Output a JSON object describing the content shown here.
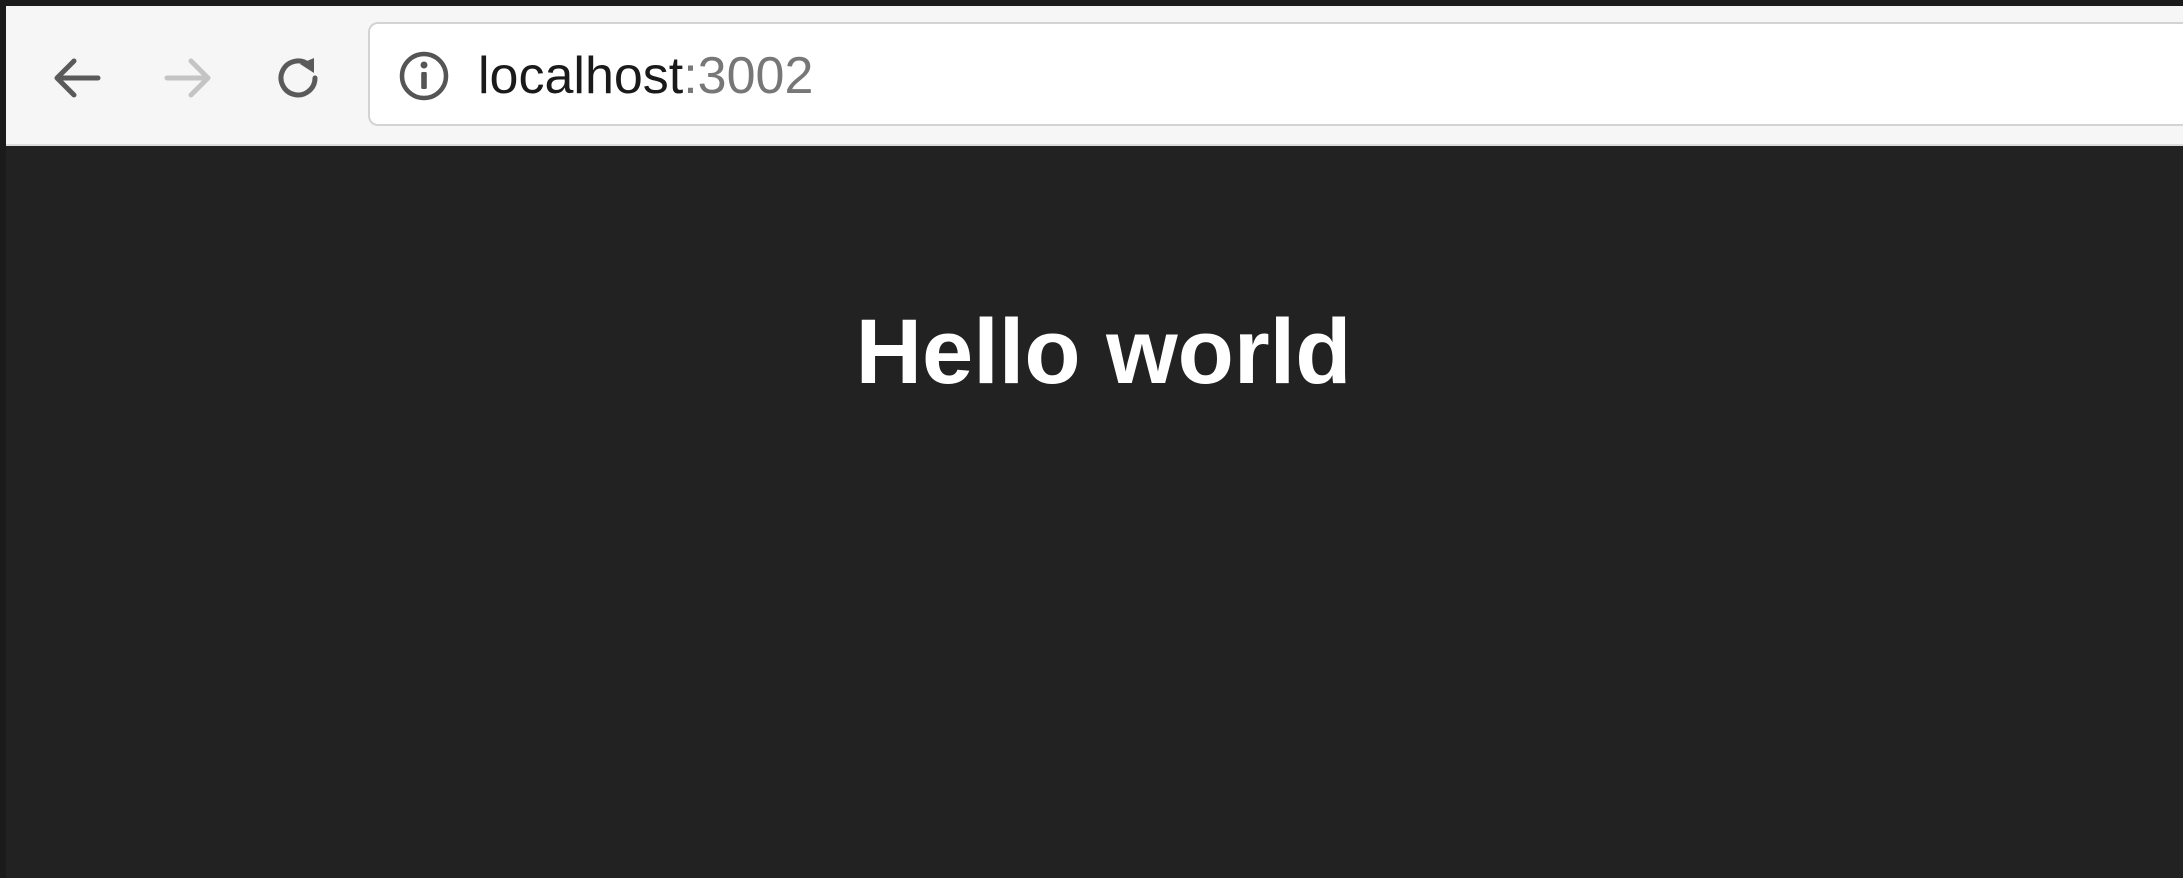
{
  "browser": {
    "address_bar": {
      "host": "localhost",
      "port": ":3002"
    },
    "icons": {
      "back": "arrow-left-icon",
      "forward": "arrow-right-icon",
      "reload": "reload-icon",
      "site_info": "info-icon"
    }
  },
  "page": {
    "heading": "Hello world"
  },
  "colors": {
    "page_background": "#222222",
    "toolbar_background": "#f6f6f6",
    "heading_text": "#ffffff",
    "port_text": "#777777"
  }
}
